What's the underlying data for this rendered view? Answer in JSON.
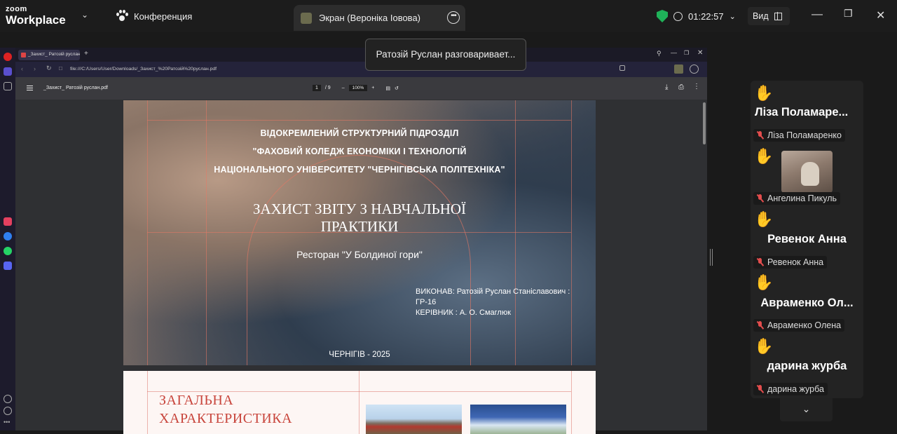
{
  "zoom": {
    "brand_top": "zoom",
    "brand_bottom": "Workplace",
    "meeting_label": "Конференция",
    "share_tab_label": "Экран (Вероніка Іовова)",
    "timer": "01:22:57",
    "view_label": "Вид",
    "speaking_tooltip": "Ратозій Руслан разговаривает...",
    "icons": {
      "shield": "shield-check-icon",
      "chevron": "chevron-down-icon",
      "more": "more-options-icon",
      "clock": "clock-icon",
      "grid": "gallery-view-icon",
      "minimize": "minimize-icon",
      "restore": "restore-icon",
      "close": "close-icon"
    },
    "accent": "#1fb259"
  },
  "browser": {
    "tab_title": "_Захист_ Ратозій руслан...",
    "url": "file:///C:/Users/User/Downloads/_Захист_%20Ратозій%20руслан.pdf",
    "pdf_name": "_Захист_ Ратозій руслан.pdf",
    "page_current": "1",
    "page_total": "/ 9",
    "zoom_level": "100%"
  },
  "slide1": {
    "org_line1": "ВІДОКРЕМЛЕНИЙ СТРУКТУРНИЙ ПІДРОЗДІЛ",
    "org_line2": "\"ФАХОВИЙ КОЛЕДЖ ЕКОНОМІКИ І ТЕХНОЛОГІЙ",
    "org_line3": "НАЦІОНАЛЬНОГО УНІВЕРСИТЕТУ \"ЧЕРНІГІВСЬКА ПОЛІТЕХНІКА\"",
    "title_line1": "ЗАХИСТ ЗВІТУ З НАВЧАЛЬНОЇ",
    "title_line2": "ПРАКТИКИ",
    "subtitle": "Ресторан \"У Болдиної гори\"",
    "author_line1": "ВИКОНАВ: Ратозій Руслан Станіславович :",
    "author_line2": "ГР-16",
    "author_line3": "КЕРІВНИК : А. О. Смаглюк",
    "city_year": "ЧЕРНІГІВ - 2025"
  },
  "slide2": {
    "title_line1": "ЗАГАЛЬНА",
    "title_line2": "ХАРАКТЕРИСТИКА"
  },
  "participants": [
    {
      "display": "Ліза  Поламаре...",
      "name": "Ліза Поламаренко",
      "hand": "✋",
      "muted": true,
      "video": false
    },
    {
      "display": "",
      "name": "Ангелина Пикуль",
      "hand": "✋",
      "muted": true,
      "video": true
    },
    {
      "display": "Ревенок Анна",
      "name": "Ревенок Анна",
      "hand": "✋",
      "muted": true,
      "video": false
    },
    {
      "display": "Авраменко  Ол...",
      "name": "Авраменко Олена",
      "hand": "✋",
      "muted": true,
      "video": false
    },
    {
      "display": "дарина журба",
      "name": "дарина журба",
      "hand": "✋",
      "muted": true,
      "video": false
    }
  ],
  "panel_scroll_icon": "chevron-down-icon"
}
